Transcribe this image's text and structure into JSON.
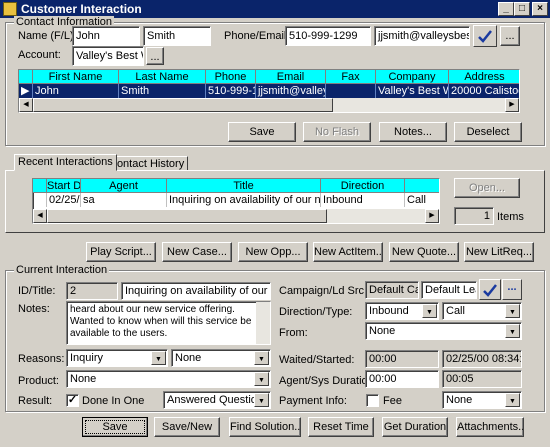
{
  "window": {
    "title": "Customer Interaction",
    "minimize": "_",
    "maximize": "□",
    "close": "×"
  },
  "contact": {
    "group_label": "Contact Information",
    "name_label": "Name (F/L):",
    "first_name": "John",
    "last_name": "Smith",
    "phone_label": "Phone/Email:",
    "phone": "510-999-1299",
    "email": "jjsmith@valleysbest.co",
    "account_label": "Account:",
    "account": "Valley's Best W",
    "ellipsis": "...",
    "grid": {
      "headers": [
        "",
        "First Name",
        "Last Name",
        "Phone",
        "Email",
        "Fax",
        "Company",
        "Address"
      ],
      "rows": [
        [
          "▶",
          "John",
          "Smith",
          "510-999-12",
          "jjsmith@valleysb",
          "",
          "Valley's Best Win",
          "20000 Calistoga R"
        ]
      ]
    },
    "buttons": {
      "save": "Save",
      "no_flash": "No Flash",
      "notes": "Notes...",
      "deselect": "Deselect"
    }
  },
  "tabs": {
    "recent": "Recent Interactions",
    "history": "Contact History"
  },
  "recent": {
    "headers": [
      "",
      "Start D",
      "Agent",
      "Title",
      "Direction",
      ""
    ],
    "rows": [
      [
        "",
        "02/25/",
        "sa",
        "Inquiring on availability of our new ser",
        "Inbound",
        "Call"
      ]
    ],
    "open": "Open...",
    "count": "1",
    "items_label": "Items"
  },
  "actions": {
    "play_script": "Play Script...",
    "new_case": "New Case...",
    "new_opp": "New Opp...",
    "new_act": "New ActItem...",
    "new_quote": "New Quote...",
    "new_litreq": "New LitReq..."
  },
  "current": {
    "group_label": "Current Interaction",
    "id_label": "ID/Title:",
    "id": "2",
    "title": "Inquiring on availability of our new s",
    "notes_label": "Notes:",
    "notes": "heard about our new service offering. Wanted to know when will this service be available to the users.",
    "reasons_label": "Reasons:",
    "reason1": "Inquiry",
    "reason2": "None",
    "product_label": "Product:",
    "product": "None",
    "result_label": "Result:",
    "done_check": "✓",
    "done_label": "Done In One",
    "result": "Answered Question",
    "campaign_label": "Campaign/Ld Src:",
    "campaign": "Default Cam",
    "lead_source": "Default Lead",
    "direction_label": "Direction/Type:",
    "direction": "Inbound",
    "type": "Call",
    "from_label": "From:",
    "from": "None",
    "waited_label": "Waited/Started:",
    "waited": "00:00",
    "started": "02/25/00 08:34:2",
    "duration_label": "Agent/Sys Duration:",
    "agent_duration": "00:00",
    "sys_duration": "00:05",
    "payment_label": "Payment Info:",
    "fee_label": "Fee",
    "payment": "None"
  },
  "footer": {
    "save": "Save",
    "save_new": "Save/New",
    "find_solution": "Find Solution...",
    "reset_time": "Reset Time",
    "get_duration": "Get Duration",
    "attachments": "Attachments..."
  },
  "colors": {
    "titlebar": "#0a246a",
    "grid_header": "#00ffff",
    "selection": "#0a246a",
    "check_accent": "#1a3aa0"
  }
}
